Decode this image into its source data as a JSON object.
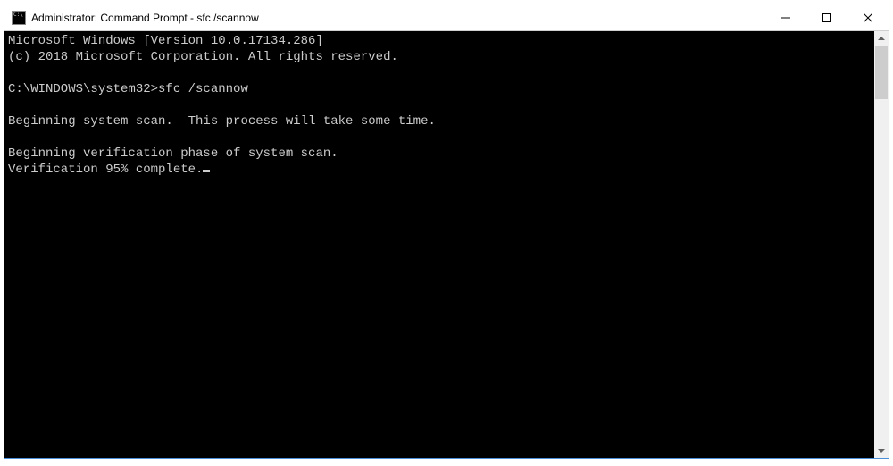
{
  "window": {
    "title": "Administrator: Command Prompt - sfc  /scannow"
  },
  "terminal": {
    "line1": "Microsoft Windows [Version 10.0.17134.286]",
    "line2": "(c) 2018 Microsoft Corporation. All rights reserved.",
    "blank1": "",
    "prompt_line": "C:\\WINDOWS\\system32>sfc /scannow",
    "blank2": "",
    "line3": "Beginning system scan.  This process will take some time.",
    "blank3": "",
    "line4": "Beginning verification phase of system scan.",
    "line5": "Verification 95% complete."
  }
}
